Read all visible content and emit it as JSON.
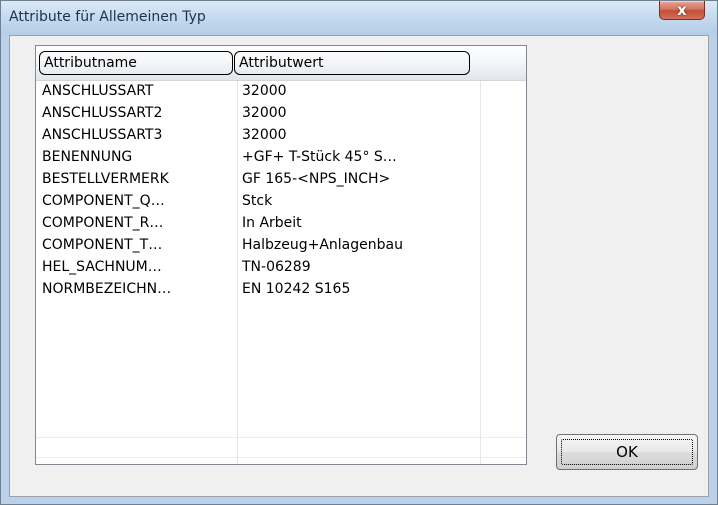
{
  "window": {
    "title": "Attribute für Allemeinen Typ",
    "close_glyph": "x"
  },
  "listview": {
    "columns": [
      "Attributname",
      "Attributwert"
    ],
    "rows": [
      {
        "name": "ANSCHLUSSART",
        "value": "32000"
      },
      {
        "name": "ANSCHLUSSART2",
        "value": "32000"
      },
      {
        "name": "ANSCHLUSSART3",
        "value": "32000"
      },
      {
        "name": "BENENNUNG",
        "value": "+GF+ T-Stück 45° S…"
      },
      {
        "name": "BESTELLVERMERK",
        "value": "GF 165-<NPS_INCH>"
      },
      {
        "name": "COMPONENT_Q…",
        "value": "Stck"
      },
      {
        "name": "COMPONENT_R…",
        "value": "In Arbeit"
      },
      {
        "name": "COMPONENT_T…",
        "value": "Halbzeug+Anlagenbau"
      },
      {
        "name": "HEL_SACHNUM…",
        "value": "TN-06289"
      },
      {
        "name": "NORMBEZEICHN…",
        "value": "EN 10242 S165"
      }
    ]
  },
  "buttons": {
    "ok_label": "OK"
  }
}
